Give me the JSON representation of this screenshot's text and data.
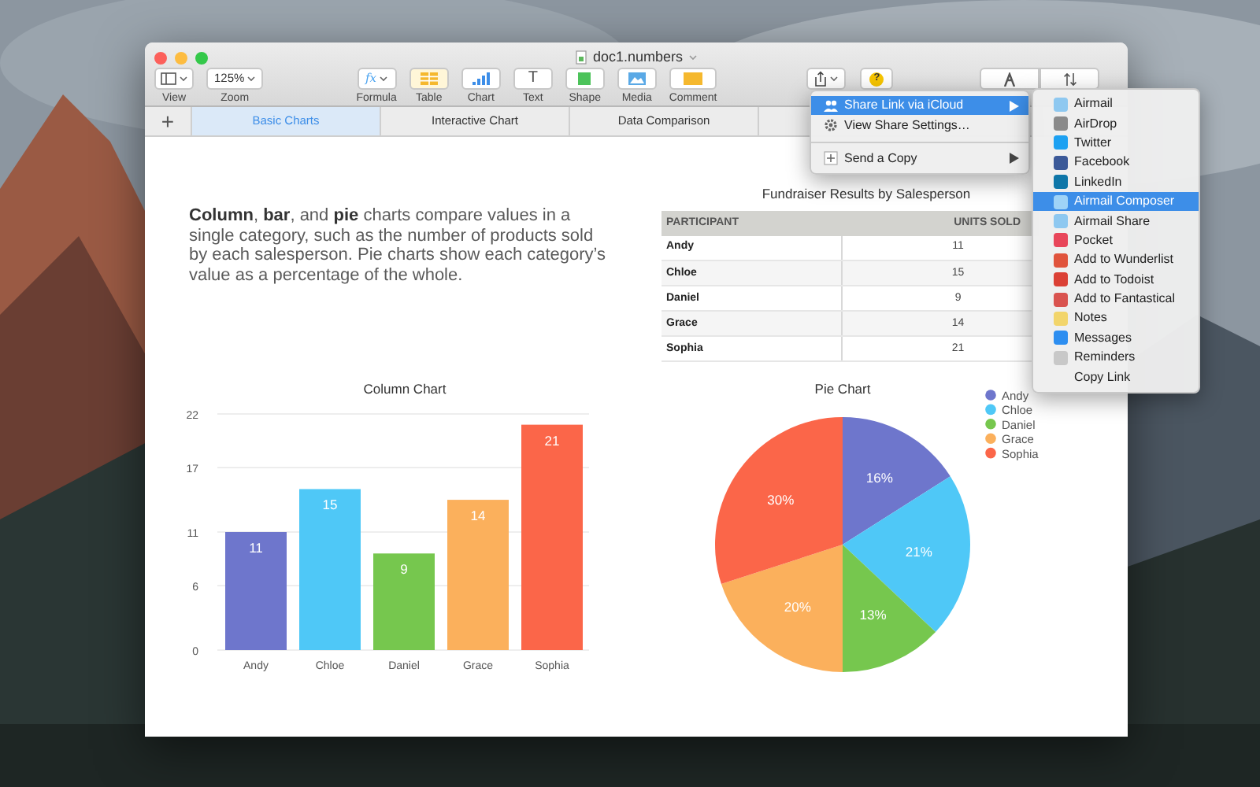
{
  "window": {
    "title": "doc1.numbers"
  },
  "toolbar": {
    "items": [
      {
        "kind": "view",
        "label": "View"
      },
      {
        "kind": "zoom",
        "label": "Zoom",
        "value": "125%"
      },
      {
        "kind": "formula",
        "label": "Formula",
        "glyph": "fx"
      },
      {
        "kind": "table",
        "label": "Table"
      },
      {
        "kind": "chart",
        "label": "Chart"
      },
      {
        "kind": "text",
        "label": "Text",
        "glyph": "T"
      },
      {
        "kind": "shape",
        "label": "Shape"
      },
      {
        "kind": "media",
        "label": "Media"
      },
      {
        "kind": "comment",
        "label": "Comment"
      }
    ],
    "right": [
      {
        "kind": "share"
      },
      {
        "kind": "help",
        "glyph": "?"
      },
      {
        "kind": "format"
      },
      {
        "kind": "organize"
      }
    ]
  },
  "sheet_tabs": {
    "add": "+",
    "tabs": [
      {
        "label": "Basic Charts",
        "selected": true
      },
      {
        "label": "Interactive Chart",
        "selected": false
      },
      {
        "label": "Data Comparison",
        "selected": false
      }
    ]
  },
  "intro": "**Column**, **bar**, and **pie** charts compare values in a single category, such as the number of products sold by each salesperson. Pie charts show each category’s value as a percentage of the whole.",
  "table": {
    "title": "Fundraiser Results by Salesperson",
    "columns": [
      "PARTICIPANT",
      "UNITS SOLD"
    ],
    "rows": [
      [
        "Andy",
        "11"
      ],
      [
        "Chloe",
        "15"
      ],
      [
        "Daniel",
        "9"
      ],
      [
        "Grace",
        "14"
      ],
      [
        "Sophia",
        "21"
      ]
    ]
  },
  "column_chart": {
    "chart_data": {
      "type": "bar",
      "title": "Column Chart",
      "categories": [
        "Andy",
        "Chloe",
        "Daniel",
        "Grace",
        "Sophia"
      ],
      "values": [
        11,
        15,
        9,
        14,
        21
      ],
      "colors": [
        "#6e76cc",
        "#4fc8f7",
        "#76c74e",
        "#fbb05c",
        "#fb6649"
      ],
      "ylim": [
        0,
        22
      ],
      "yticks": [
        0,
        6,
        11,
        17,
        22
      ],
      "grid": true,
      "value_labels": [
        "11",
        "15",
        "9",
        "14",
        "21"
      ]
    }
  },
  "pie_chart": {
    "chart_data": {
      "type": "pie",
      "title": "Pie Chart",
      "categories": [
        "Andy",
        "Chloe",
        "Daniel",
        "Grace",
        "Sophia"
      ],
      "values": [
        16,
        21,
        13,
        20,
        30
      ],
      "colors": [
        "#6e76cc",
        "#4fc8f7",
        "#76c74e",
        "#fbb05c",
        "#fb6649"
      ],
      "value_labels": [
        "16%",
        "21%",
        "13%",
        "20%",
        "30%"
      ],
      "legend": "right"
    }
  },
  "share_menu": {
    "items": [
      {
        "kind": "share-link",
        "label": "Share Link via iCloud",
        "submenu": true,
        "selected": true
      },
      {
        "kind": "settings",
        "label": "View Share Settings…",
        "submenu": false,
        "selected": false
      },
      {
        "kind": "separator"
      },
      {
        "kind": "send",
        "label": "Send a Copy",
        "submenu": true,
        "selected": false
      }
    ]
  },
  "share_submenu": {
    "items": [
      {
        "label": "Airmail",
        "color": "#8ec8f0",
        "selected": false
      },
      {
        "label": "AirDrop",
        "color": "#8a8a8a",
        "selected": false
      },
      {
        "label": "Twitter",
        "color": "#1da1f2",
        "selected": false
      },
      {
        "label": "Facebook",
        "color": "#3b5998",
        "selected": false
      },
      {
        "label": "LinkedIn",
        "color": "#0e76a8",
        "selected": false
      },
      {
        "label": "Airmail Composer",
        "color": "#9fd3f7",
        "selected": true
      },
      {
        "label": "Airmail Share",
        "color": "#8ec8f0",
        "selected": false
      },
      {
        "label": "Pocket",
        "color": "#e8465a",
        "selected": false
      },
      {
        "label": "Add to Wunderlist",
        "color": "#e0533c",
        "selected": false
      },
      {
        "label": "Add to Todoist",
        "color": "#db4035",
        "selected": false
      },
      {
        "label": "Add to Fantastical",
        "color": "#d9534f",
        "selected": false
      },
      {
        "label": "Notes",
        "color": "#f2d56b",
        "selected": false
      },
      {
        "label": "Messages",
        "color": "#2d8ef0",
        "selected": false
      },
      {
        "label": "Reminders",
        "color": "#c8c8c8",
        "selected": false
      },
      {
        "label": "Copy Link",
        "selected": false
      }
    ]
  }
}
